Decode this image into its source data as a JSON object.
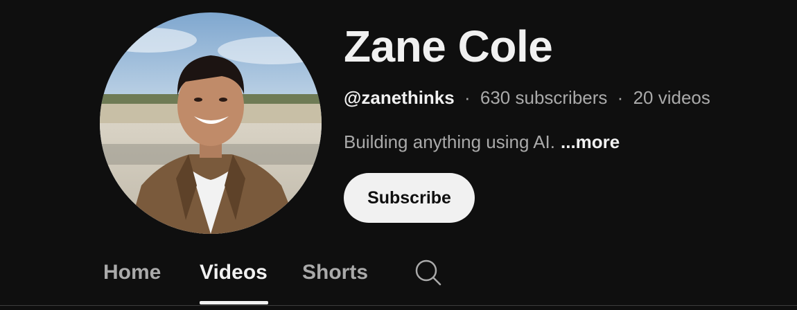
{
  "channel": {
    "name": "Zane Cole",
    "handle": "@zanethinks",
    "subscribers": "630 subscribers",
    "videos": "20 videos",
    "separator": "·",
    "description": "Building anything using AI.",
    "more_label": "...more",
    "avatar_icon": "avatar-photo"
  },
  "subscribe": {
    "label": "Subscribe"
  },
  "tabs": [
    {
      "label": "Home",
      "active": false
    },
    {
      "label": "Videos",
      "active": true
    },
    {
      "label": "Shorts",
      "active": false
    }
  ],
  "search_icon": "search-icon",
  "colors": {
    "background": "#0f0f0f",
    "text_primary": "#f1f1f1",
    "text_secondary": "#aaaaaa",
    "button_bg": "#f1f1f1",
    "divider": "#3d3d3d"
  }
}
